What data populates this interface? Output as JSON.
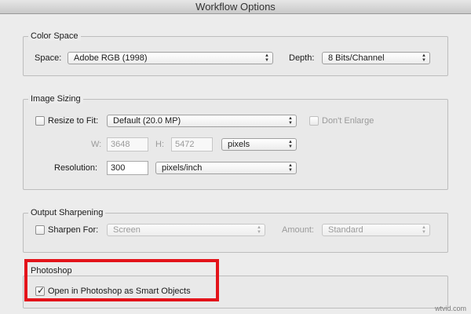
{
  "window": {
    "title": "Workflow Options"
  },
  "color_space": {
    "legend": "Color Space",
    "space_label": "Space:",
    "space_value": "Adobe RGB (1998)",
    "depth_label": "Depth:",
    "depth_value": "8 Bits/Channel"
  },
  "image_sizing": {
    "legend": "Image Sizing",
    "resize_label": "Resize to Fit:",
    "resize_checked": false,
    "resize_value": "Default  (20.0 MP)",
    "dont_enlarge_label": "Don't Enlarge",
    "w_label": "W:",
    "w_value": "3648",
    "h_label": "H:",
    "h_value": "5472",
    "units_value": "pixels",
    "resolution_label": "Resolution:",
    "resolution_value": "300",
    "resolution_units": "pixels/inch"
  },
  "output_sharpening": {
    "legend": "Output Sharpening",
    "sharpen_label": "Sharpen For:",
    "sharpen_value": "Screen",
    "amount_label": "Amount:",
    "amount_value": "Standard"
  },
  "photoshop": {
    "legend": "Photoshop",
    "smart_objects_label": "Open in Photoshop as Smart Objects",
    "smart_objects_checked": true
  },
  "colors": {
    "highlight": "#e3131a"
  },
  "watermark": "wtvid.com"
}
